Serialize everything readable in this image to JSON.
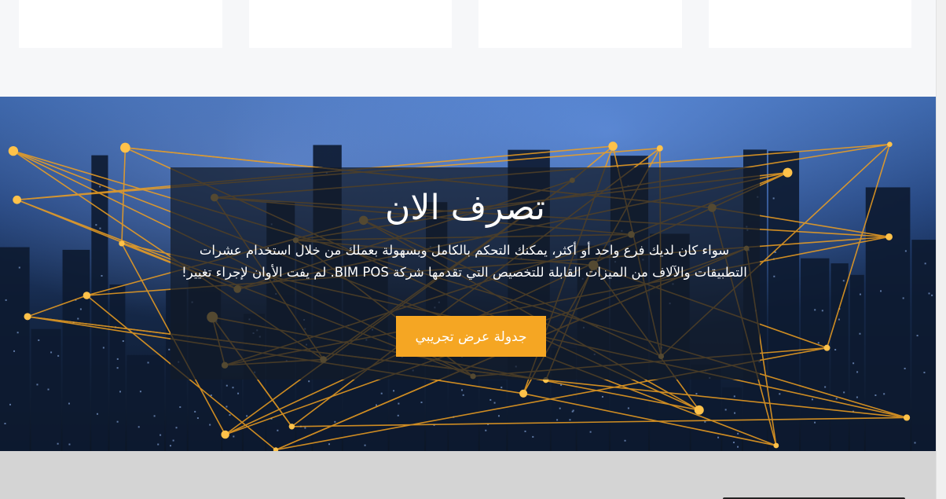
{
  "hero": {
    "title": "تصرف الان",
    "description": "سواء كان لديك فرع واحد أو أكثر، يمكنك التحكم بالكامل وبسهولة بعملك من خلال استخدام عشرات التطبيقات والآلاف من الميزات القابلة للتخصيص التي تقدمها شركة BIM POS. لم يفت الأوان لإجراء تغيير!",
    "cta_label": "جدولة عرض تجريبي"
  },
  "colors": {
    "cta": "#f5a623",
    "overlay": "#121a28",
    "network_lines": "#f0a020"
  }
}
